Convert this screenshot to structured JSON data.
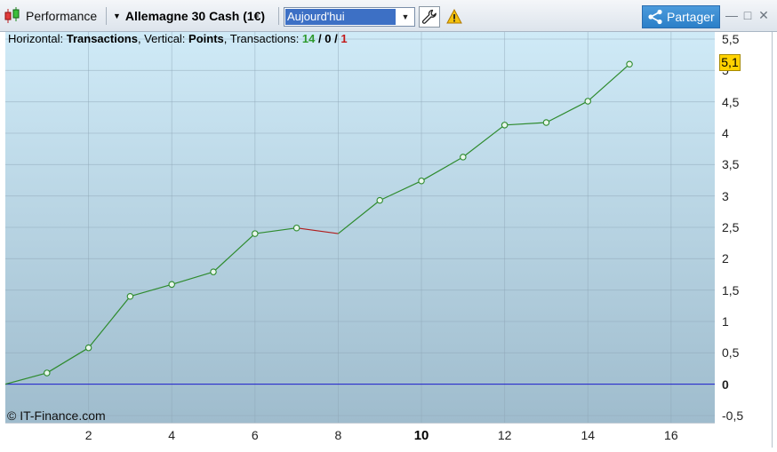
{
  "toolbar": {
    "title": "Performance",
    "instrument": "Allemagne 30 Cash (1€)",
    "period_value": "Aujourd'hui",
    "share_label": "Partager"
  },
  "legend": {
    "horizontal_prefix": "Horizontal: ",
    "horizontal_value": "Transactions",
    "vertical_prefix": ", Vertical: ",
    "vertical_value": "Points",
    "transactions_prefix": ", Transactions: ",
    "winning": "14",
    "slash1": " / ",
    "neutral": "0",
    "slash2": " / ",
    "losing": "1"
  },
  "watermark": "© IT-Finance.com",
  "current_value": "5,1",
  "icons": {
    "chart_type": "candlestick-icon",
    "settings": "wrench-icon",
    "warning": "warning-icon",
    "share": "share-icon"
  },
  "colors": {
    "gain_line": "#2e8b2e",
    "loss_line": "#b01c1c",
    "zero_line": "#1a1acc",
    "bg_top": "#cfeaf7",
    "bg_bottom": "#9fbccd",
    "badge": "#ffd200"
  },
  "chart_data": {
    "type": "line",
    "x": [
      0,
      1,
      2,
      3,
      4,
      5,
      6,
      7,
      8,
      9,
      10,
      11,
      12,
      13,
      14,
      15
    ],
    "y": [
      0,
      0.18,
      0.58,
      1.4,
      1.59,
      1.79,
      2.4,
      2.49,
      2.4,
      2.93,
      3.24,
      3.62,
      4.13,
      4.17,
      4.51,
      5.1
    ],
    "segment_colors": [
      "gain",
      "gain",
      "gain",
      "gain",
      "gain",
      "gain",
      "gain",
      "loss",
      "gain",
      "gain",
      "gain",
      "gain",
      "gain",
      "gain",
      "gain"
    ],
    "markers_at": [
      1,
      2,
      3,
      4,
      5,
      6,
      7,
      9,
      10,
      11,
      12,
      13,
      14,
      15
    ],
    "xlabel": "Transactions",
    "ylabel": "Points",
    "xlim": [
      0,
      17.05
    ],
    "ylim": [
      -0.5,
      5.5
    ],
    "x_ticks": [
      "2",
      "4",
      "6",
      "8",
      "10",
      "12",
      "14",
      "16"
    ],
    "x_tick_values": [
      2,
      4,
      6,
      8,
      10,
      12,
      14,
      16
    ],
    "x_major": "10",
    "y_ticks": [
      "5,5",
      "5",
      "4,5",
      "4",
      "3,5",
      "3",
      "2,5",
      "2",
      "1,5",
      "1",
      "0,5",
      "0",
      "-0,5"
    ],
    "y_tick_values": [
      5.5,
      5,
      4.5,
      4,
      3.5,
      3,
      2.5,
      2,
      1.5,
      1,
      0.5,
      0,
      -0.5
    ],
    "grid": true
  }
}
